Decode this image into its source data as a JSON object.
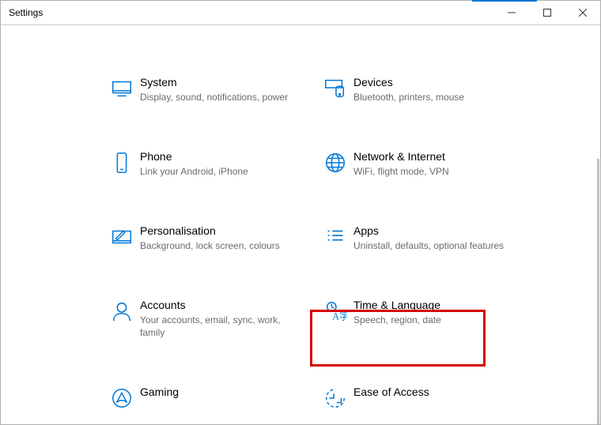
{
  "window": {
    "title": "Settings"
  },
  "tiles": [
    {
      "label": "System",
      "sub": "Display, sound, notifications, power"
    },
    {
      "label": "Devices",
      "sub": "Bluetooth, printers, mouse"
    },
    {
      "label": "Phone",
      "sub": "Link your Android, iPhone"
    },
    {
      "label": "Network & Internet",
      "sub": "WiFi, flight mode, VPN"
    },
    {
      "label": "Personalisation",
      "sub": "Background, lock screen, colours"
    },
    {
      "label": "Apps",
      "sub": "Uninstall, defaults, optional features"
    },
    {
      "label": "Accounts",
      "sub": "Your accounts, email, sync, work, family"
    },
    {
      "label": "Time & Language",
      "sub": "Speech, region, date"
    },
    {
      "label": "Gaming",
      "sub": ""
    },
    {
      "label": "Ease of Access",
      "sub": ""
    }
  ]
}
